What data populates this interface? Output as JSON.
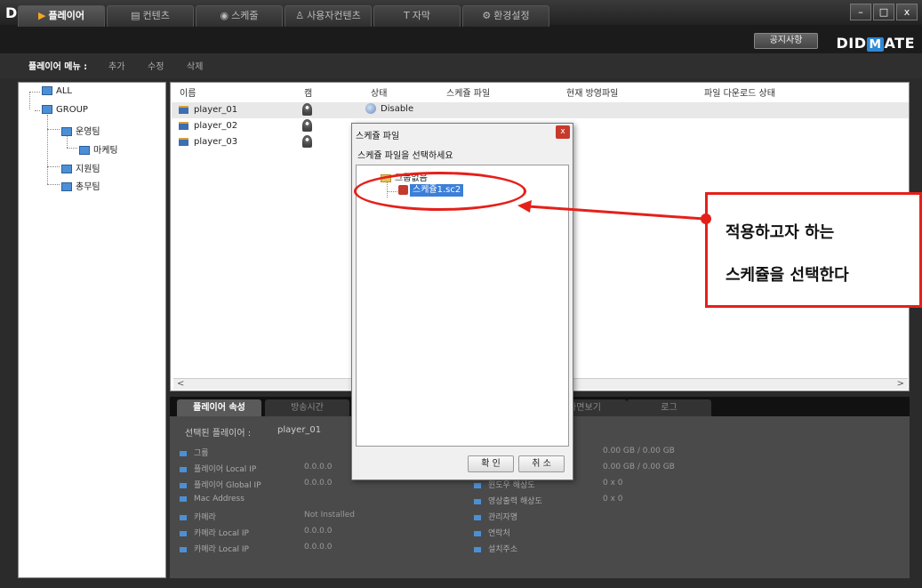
{
  "app": {
    "logo_prefix": "DID",
    "logo_mark": "M",
    "logo_suffix": "ATE",
    "window_controls": [
      "–",
      "□",
      "x"
    ]
  },
  "tabs": [
    {
      "label": "플레이어",
      "icon": "play-icon",
      "active": true
    },
    {
      "label": "컨텐츠",
      "icon": "content-icon",
      "active": false
    },
    {
      "label": "스케줄",
      "icon": "schedule-icon",
      "active": false
    },
    {
      "label": "사용자컨텐츠",
      "icon": "user-content-icon",
      "active": false
    },
    {
      "label": "자막",
      "icon": "subtitle-icon",
      "active": false
    },
    {
      "label": "환경설정",
      "icon": "settings-icon",
      "active": false
    }
  ],
  "notice_button": "공지사항",
  "menu": {
    "label": "플레이어 메뉴 :",
    "items": [
      "추가",
      "수정",
      "삭제"
    ]
  },
  "tree": {
    "nodes": [
      "ALL",
      "GROUP",
      "운영팀",
      "마케팅",
      "지원팀",
      "총무팀"
    ]
  },
  "list": {
    "columns": [
      "이름",
      "캠",
      "상태",
      "스케쥴 파일",
      "현재 방영파일",
      "파일 다운로드 상태"
    ],
    "rows": [
      {
        "name": "player_01",
        "status": "Disable"
      },
      {
        "name": "player_02",
        "status": ""
      },
      {
        "name": "player_03",
        "status": ""
      }
    ],
    "scroll_left": "<",
    "scroll_right": ">"
  },
  "bottom_tabs": [
    "플레이어 속성",
    "방송시간",
    "화면보기",
    "로그"
  ],
  "properties": {
    "selected_label": "선택된 플레이어 :",
    "selected_value": "player_01",
    "left": [
      {
        "label": "그룹",
        "value": ""
      },
      {
        "label": "플레이어 Local IP",
        "value": "0.0.0.0"
      },
      {
        "label": "플레이어 Global IP",
        "value": "0.0.0.0"
      },
      {
        "label": "Mac Address",
        "value": ""
      },
      {
        "label": "카메라",
        "value": "Not Installed"
      },
      {
        "label": "카메라 Local IP",
        "value": "0.0.0.0"
      },
      {
        "label": "카메라 Local IP",
        "value": "0.0.0.0"
      }
    ],
    "right": [
      {
        "label": "",
        "value": "0.00 GB / 0.00 GB"
      },
      {
        "label": "",
        "value": "0.00 GB / 0.00 GB"
      },
      {
        "label": "윈도우 해상도",
        "value": "0 x 0"
      },
      {
        "label": "영상출력 해상도",
        "value": "0 x 0"
      },
      {
        "label": "관리자명",
        "value": ""
      },
      {
        "label": "연락처",
        "value": ""
      },
      {
        "label": "설치주소",
        "value": ""
      }
    ]
  },
  "dialog": {
    "title": "스케쥴 파일",
    "close": "x",
    "prompt": "스케쥴 파일을 선택하세요",
    "group": "그룹없음",
    "file": "스케쥴1.sc2",
    "ok": "확 인",
    "cancel": "취 소"
  },
  "annotation": {
    "line1": "적용하고자 하는",
    "line2": "스케쥴을 선택한다",
    "color": "#e5201a"
  }
}
